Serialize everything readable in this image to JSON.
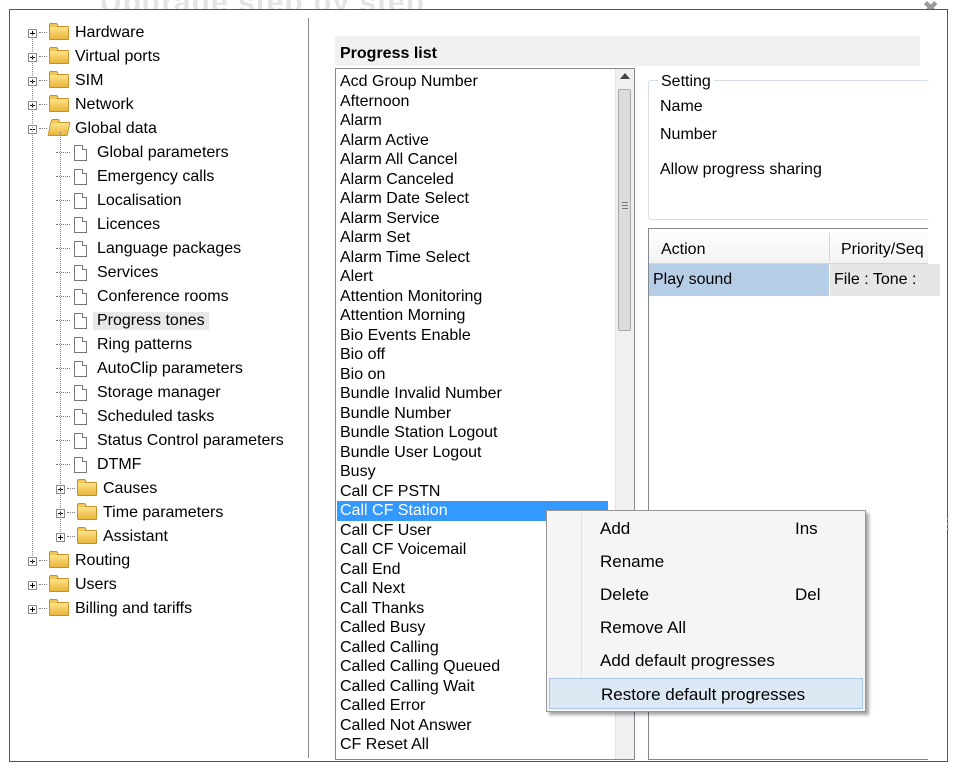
{
  "background_title": "Upgrade step by step",
  "tree": {
    "items": [
      {
        "label": "Hardware",
        "level": 0,
        "kind": "folder",
        "state": "collapsed"
      },
      {
        "label": "Virtual ports",
        "level": 0,
        "kind": "folder",
        "state": "collapsed"
      },
      {
        "label": "SIM",
        "level": 0,
        "kind": "folder",
        "state": "collapsed"
      },
      {
        "label": "Network",
        "level": 0,
        "kind": "folder",
        "state": "collapsed"
      },
      {
        "label": "Global data",
        "level": 0,
        "kind": "folder",
        "state": "expanded"
      },
      {
        "label": "Global parameters",
        "level": 1,
        "kind": "doc"
      },
      {
        "label": "Emergency calls",
        "level": 1,
        "kind": "doc"
      },
      {
        "label": "Localisation",
        "level": 1,
        "kind": "doc"
      },
      {
        "label": "Licences",
        "level": 1,
        "kind": "doc"
      },
      {
        "label": "Language packages",
        "level": 1,
        "kind": "doc"
      },
      {
        "label": "Services",
        "level": 1,
        "kind": "doc"
      },
      {
        "label": "Conference rooms",
        "level": 1,
        "kind": "doc"
      },
      {
        "label": "Progress tones",
        "level": 1,
        "kind": "doc",
        "selected": true
      },
      {
        "label": "Ring patterns",
        "level": 1,
        "kind": "doc"
      },
      {
        "label": "AutoClip parameters",
        "level": 1,
        "kind": "doc"
      },
      {
        "label": "Storage manager",
        "level": 1,
        "kind": "doc"
      },
      {
        "label": "Scheduled tasks",
        "level": 1,
        "kind": "doc"
      },
      {
        "label": "Status Control parameters",
        "level": 1,
        "kind": "doc"
      },
      {
        "label": "DTMF",
        "level": 1,
        "kind": "doc"
      },
      {
        "label": "Causes",
        "level": 1,
        "kind": "folder",
        "state": "collapsed"
      },
      {
        "label": "Time parameters",
        "level": 1,
        "kind": "folder",
        "state": "collapsed"
      },
      {
        "label": "Assistant",
        "level": 1,
        "kind": "folder",
        "state": "collapsed"
      },
      {
        "label": "Routing",
        "level": 0,
        "kind": "folder",
        "state": "collapsed"
      },
      {
        "label": "Users",
        "level": 0,
        "kind": "folder",
        "state": "collapsed"
      },
      {
        "label": "Billing and tariffs",
        "level": 0,
        "kind": "folder",
        "state": "collapsed"
      }
    ]
  },
  "progress_list": {
    "header": "Progress list",
    "selected_index": 22,
    "items": [
      "Acd Group Number",
      "Afternoon",
      "Alarm",
      "Alarm Active",
      "Alarm All Cancel",
      "Alarm Canceled",
      "Alarm Date Select",
      "Alarm Service",
      "Alarm Set",
      "Alarm Time Select",
      "Alert",
      "Attention Monitoring",
      "Attention Morning",
      "Bio Events Enable",
      "Bio off",
      "Bio on",
      "Bundle Invalid Number",
      "Bundle Number",
      "Bundle Station Logout",
      "Bundle User Logout",
      "Busy",
      "Call CF PSTN",
      "Call CF Station",
      "Call CF User",
      "Call CF Voicemail",
      "Call End",
      "Call Next",
      "Call Thanks",
      "Called Busy",
      "Called Calling",
      "Called Calling Queued",
      "Called Calling Wait",
      "Called Error",
      "Called Not Answer",
      "CF Reset All"
    ]
  },
  "setting": {
    "legend": "Setting",
    "name_label": "Name",
    "number_label": "Number",
    "allow_sharing_label": "Allow progress sharing"
  },
  "actions_grid": {
    "columns": [
      "Action",
      "Priority/Seq"
    ],
    "rows": [
      {
        "action": "Play sound",
        "priority": "File : Tone :"
      }
    ]
  },
  "context_menu": {
    "items": [
      {
        "label": "Add",
        "shortcut": "Ins"
      },
      {
        "label": "Rename",
        "shortcut": ""
      },
      {
        "label": "Delete",
        "shortcut": "Del"
      },
      {
        "label": "Remove All",
        "shortcut": ""
      },
      {
        "label": "Add default progresses",
        "shortcut": ""
      },
      {
        "label": "Restore default progresses",
        "shortcut": "",
        "highlighted": true
      }
    ]
  }
}
